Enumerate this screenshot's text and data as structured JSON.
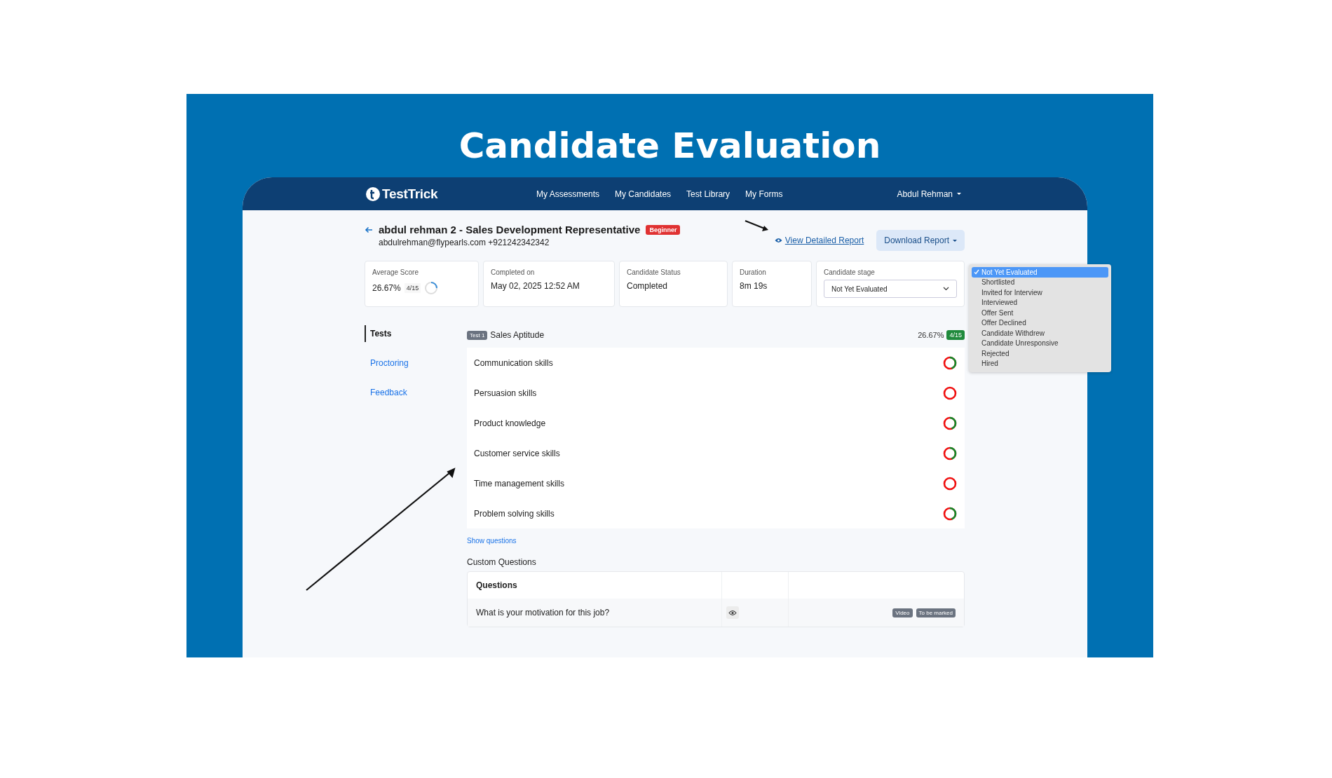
{
  "banner": {
    "title": "Candidate Evaluation"
  },
  "nav": {
    "brand": "TestTrick",
    "links": [
      "My Assessments",
      "My Candidates",
      "Test Library",
      "My Forms"
    ],
    "user": "Abdul Rehman"
  },
  "candidate": {
    "name": "abdul rehman 2 - Sales Development Representative",
    "level_badge": "Beginner",
    "contact": "abdulrehman@flypearls.com +921242342342"
  },
  "actions": {
    "view_report": "View Detailed Report",
    "download": "Download Report"
  },
  "stats": [
    {
      "label": "Average Score",
      "value": "26.67%",
      "kind": "score",
      "score": "4/15"
    },
    {
      "label": "Completed on",
      "value": "May 02, 2025 12:52 AM",
      "kind": "text"
    },
    {
      "label": "Candidate Status",
      "value": "Completed",
      "kind": "text"
    },
    {
      "label": "Duration",
      "value": "8m 19s",
      "kind": "text"
    },
    {
      "label": "Candidate stage",
      "value": "Not Yet Evaluated",
      "kind": "select"
    }
  ],
  "stage_menu": [
    {
      "label": "Not Yet Evaluated",
      "selected": true
    },
    {
      "label": "Shortlisted",
      "selected": false
    },
    {
      "label": "Invited for Interview",
      "selected": false
    },
    {
      "label": "Interviewed",
      "selected": false
    },
    {
      "label": "Offer Sent",
      "selected": false
    },
    {
      "label": "Offer Declined",
      "selected": false
    },
    {
      "label": "Candidate Withdrew",
      "selected": false
    },
    {
      "label": "Candidate Unresponsive",
      "selected": false
    },
    {
      "label": "Rejected",
      "selected": false
    },
    {
      "label": "Hired",
      "selected": false
    }
  ],
  "side_tabs": [
    {
      "label": "Tests",
      "selected": true
    },
    {
      "label": "Proctoring",
      "selected": false
    },
    {
      "label": "Feedback",
      "selected": false
    }
  ],
  "test": {
    "tag": "Test 1",
    "name": "Sales Aptitude",
    "percent": "26.67%",
    "score": "4/15"
  },
  "skills": [
    {
      "name": "Communication skills",
      "kind": "partial"
    },
    {
      "name": "Persuasion skills",
      "kind": "none"
    },
    {
      "name": "Product knowledge",
      "kind": "partial"
    },
    {
      "name": "Customer service skills",
      "kind": "partial"
    },
    {
      "name": "Time management skills",
      "kind": "none"
    },
    {
      "name": "Problem solving skills",
      "kind": "partial"
    }
  ],
  "show_questions": "Show questions",
  "custom": {
    "title": "Custom Questions",
    "header": "Questions",
    "rows": [
      {
        "question": "What is your motivation for this job?",
        "tags": [
          "Video",
          "To be marked"
        ]
      }
    ]
  }
}
